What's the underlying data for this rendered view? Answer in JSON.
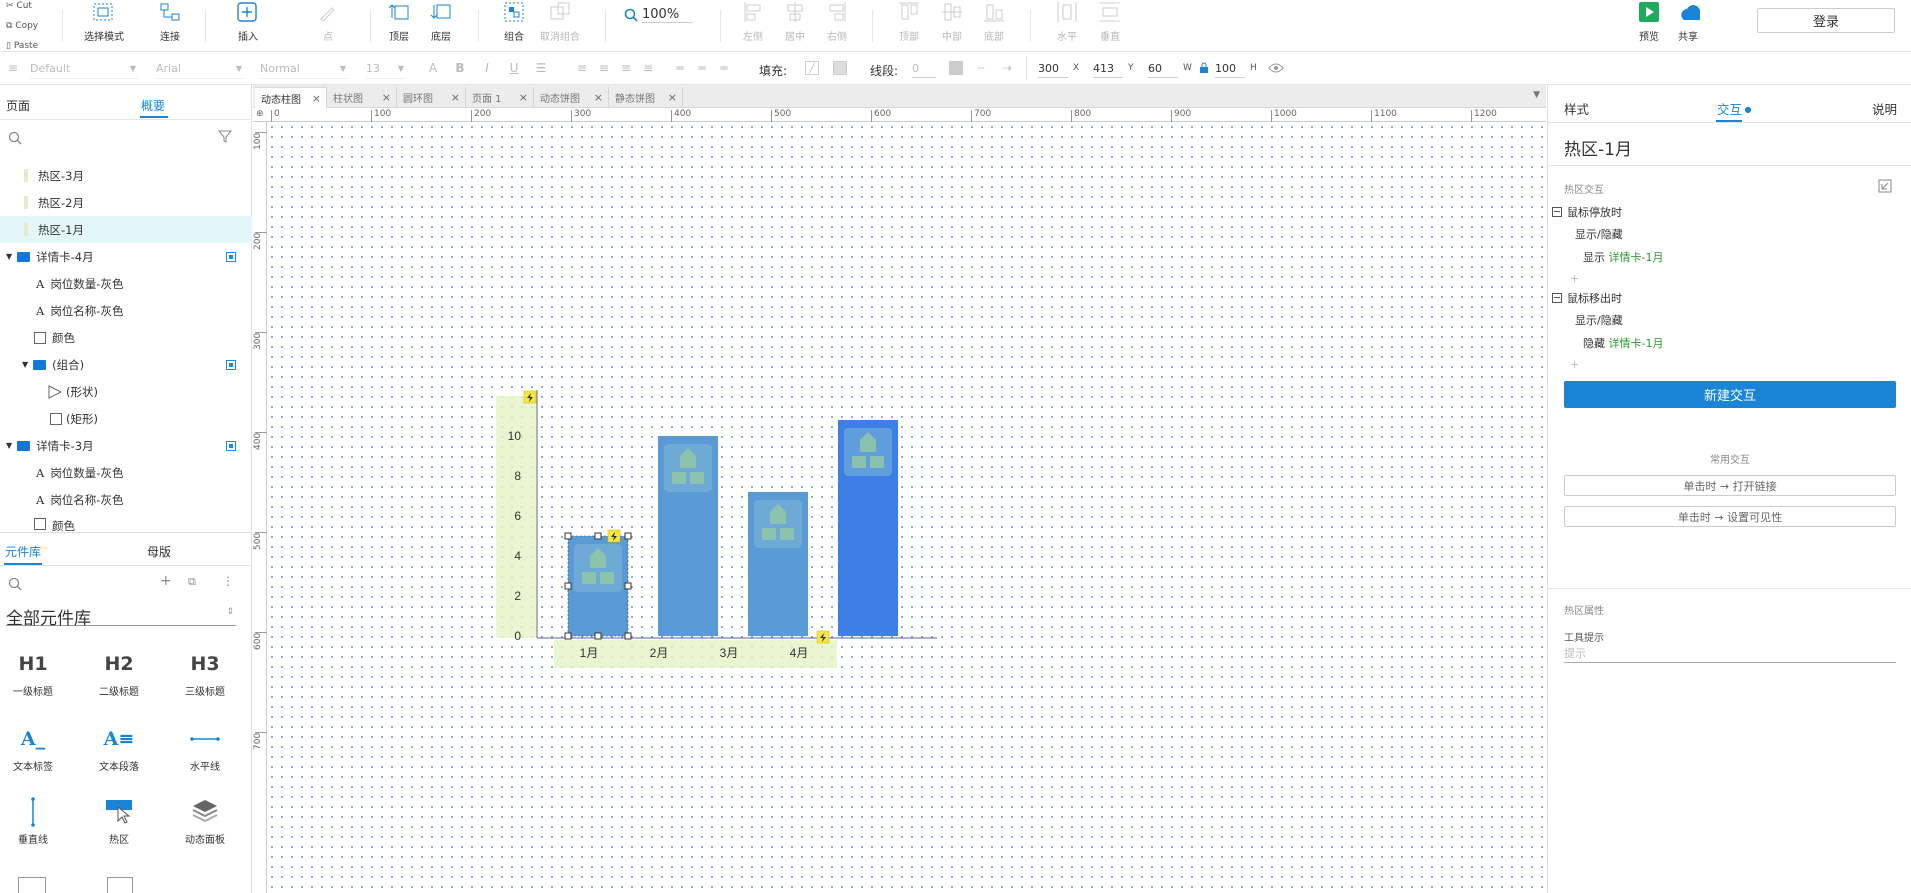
{
  "clipboard": {
    "cut": "Cut",
    "copy": "Copy",
    "paste": "Paste"
  },
  "toolbar": {
    "select_mode": "选择模式",
    "connect": "连接",
    "insert": "插入",
    "point": "点",
    "top_layer": "顶层",
    "bottom_layer": "底层",
    "group": "组合",
    "ungroup": "取消组合",
    "zoom": "100%",
    "align_left": "左侧",
    "align_center": "居中",
    "align_right": "右侧",
    "align_top": "顶部",
    "align_middle": "中部",
    "align_bottom": "底部",
    "horizontal": "水平",
    "vertical": "垂直",
    "preview": "预览",
    "share": "共享",
    "login": "登录"
  },
  "format": {
    "style": "Default",
    "font": "Arial",
    "weight": "Normal",
    "size": "13",
    "fill_label": "填充:",
    "line_label": "线段:",
    "line_width": "0",
    "x": "300",
    "x_label": "X",
    "y": "413",
    "y_label": "Y",
    "w": "60",
    "w_label": "W",
    "h": "100",
    "h_label": "H"
  },
  "left_panel": {
    "tab_pages": "页面",
    "tab_outline": "概要",
    "outline": [
      {
        "label": "热区-3月"
      },
      {
        "label": "热区-2月"
      },
      {
        "label": "热区-1月"
      },
      {
        "label": "详情卡-4月"
      },
      {
        "label": "岗位数量-灰色"
      },
      {
        "label": "岗位名称-灰色"
      },
      {
        "label": "颜色"
      },
      {
        "label": "(组合)"
      },
      {
        "label": "(形状)"
      },
      {
        "label": "(矩形)"
      },
      {
        "label": "详情卡-3月"
      },
      {
        "label": "岗位数量-灰色"
      },
      {
        "label": "岗位名称-灰色"
      },
      {
        "label": "颜色"
      }
    ],
    "tab_library": "元件库",
    "tab_masters": "母版",
    "library_select": "全部元件库",
    "library_items": [
      {
        "glyph": "H1",
        "label": "一级标题"
      },
      {
        "glyph": "H2",
        "label": "二级标题"
      },
      {
        "glyph": "H3",
        "label": "三级标题"
      },
      {
        "glyph": "A_",
        "label": "文本标签"
      },
      {
        "glyph": "A≡",
        "label": "文本段落"
      },
      {
        "glyph": "",
        "label": "水平线"
      },
      {
        "glyph": "",
        "label": "垂直线"
      },
      {
        "glyph": "",
        "label": "热区"
      },
      {
        "glyph": "",
        "label": "动态面板"
      }
    ]
  },
  "doc_tabs": [
    {
      "label": "动态柱图",
      "active": true
    },
    {
      "label": "柱状图",
      "active": false
    },
    {
      "label": "圆环图",
      "active": false
    },
    {
      "label": "页面 1",
      "active": false
    },
    {
      "label": "动态饼图",
      "active": false
    },
    {
      "label": "静态饼图",
      "active": false
    }
  ],
  "ruler": {
    "h": [
      "0",
      "100",
      "200",
      "300",
      "400",
      "500",
      "600",
      "700",
      "800",
      "900",
      "1000",
      "1100",
      "1200"
    ],
    "v": [
      "100",
      "200",
      "300",
      "400",
      "500",
      "600",
      "700"
    ]
  },
  "chart_data": {
    "type": "bar",
    "categories": [
      "1月",
      "2月",
      "3月",
      "4月"
    ],
    "values": [
      5,
      10,
      7.2,
      10.8
    ],
    "y_ticks": [
      "0",
      "2",
      "4",
      "6",
      "8",
      "10"
    ],
    "ylim": [
      0,
      11
    ],
    "colors": [
      "#5b9bd5",
      "#5b9bd5",
      "#5b9bd5",
      "#3d7fe6"
    ],
    "hotzone_color": "#e5f5c8"
  },
  "right_panel": {
    "tab_style": "样式",
    "tab_interaction": "交互",
    "tab_notes": "说明",
    "widget_name": "热区-1月",
    "section_title": "热区交互",
    "event1": "鼠标停放时",
    "event1_action": "显示/隐藏",
    "event1_detail_verb": "显示",
    "event1_detail_target": "详情卡-1月",
    "event2": "鼠标移出时",
    "event2_action": "显示/隐藏",
    "event2_detail_verb": "隐藏",
    "event2_detail_target": "详情卡-1月",
    "new_interaction": "新建交互",
    "common_title": "常用交互",
    "common1": "单击时 → 打开链接",
    "common2": "单击时 → 设置可见性",
    "props_title": "热区属性",
    "tooltip_label": "工具提示",
    "tooltip_placeholder": "提示"
  },
  "colors": {
    "accent": "#1a85d6",
    "green": "#2e9a2e"
  }
}
